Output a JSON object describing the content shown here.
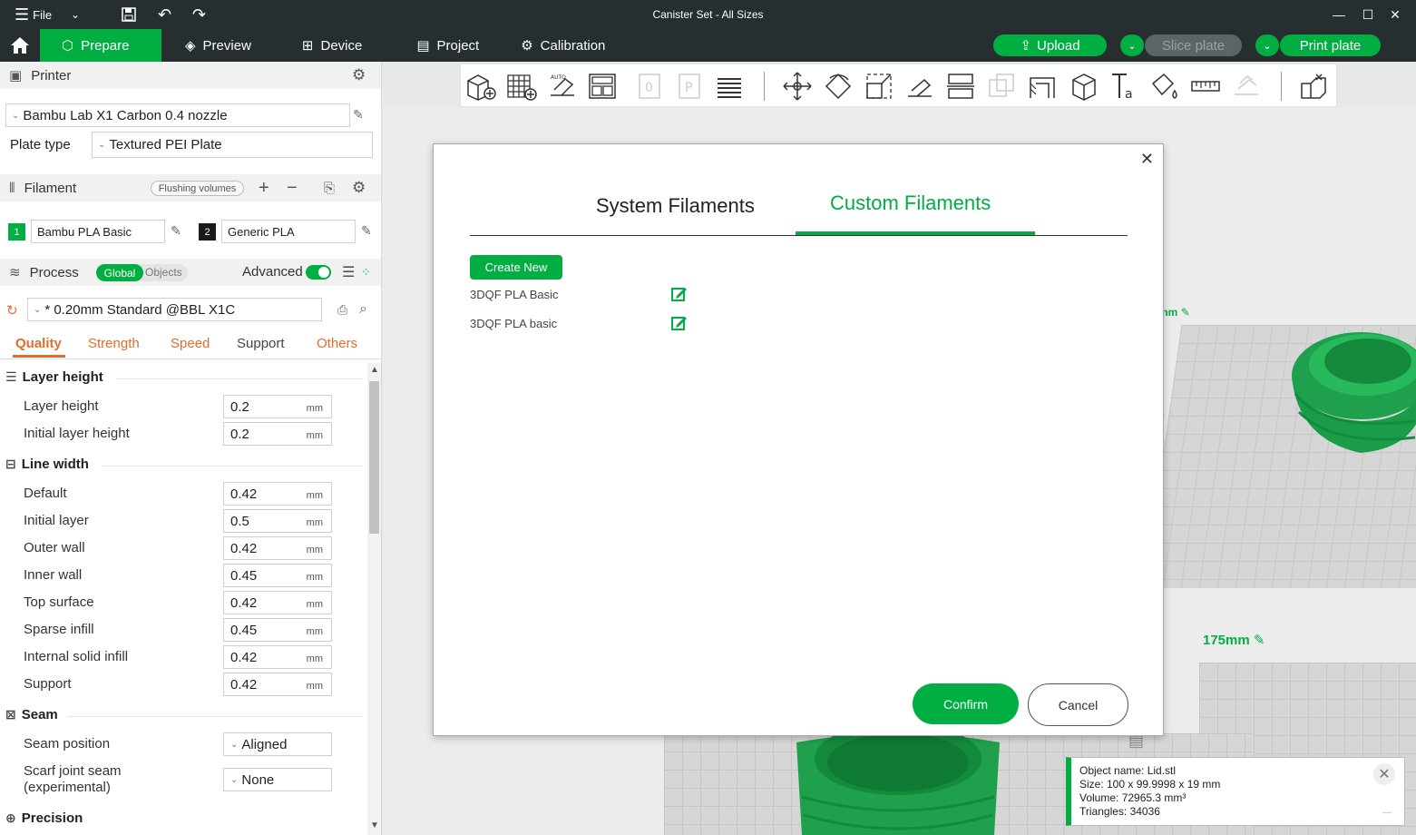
{
  "titlebar": {
    "menu_label": "File",
    "title": "Canister Set - All Sizes"
  },
  "tabs": [
    {
      "label": "Prepare"
    },
    {
      "label": "Preview"
    },
    {
      "label": "Device"
    },
    {
      "label": "Project"
    },
    {
      "label": "Calibration"
    }
  ],
  "actions": {
    "upload": "Upload",
    "slice": "Slice plate",
    "print": "Print plate"
  },
  "printer": {
    "section": "Printer",
    "name": "Bambu Lab X1 Carbon 0.4 nozzle",
    "plate_label": "Plate type",
    "plate_value": "Textured PEI Plate"
  },
  "filament": {
    "section": "Filament",
    "flushing": "Flushing volumes",
    "slots": [
      {
        "num": "1",
        "name": "Bambu PLA Basic",
        "color": "#00ae42"
      },
      {
        "num": "2",
        "name": "Generic PLA",
        "color": "#1a1a1a"
      }
    ]
  },
  "process": {
    "section": "Process",
    "global": "Global",
    "objects": "Objects",
    "advanced": "Advanced",
    "preset": "* 0.20mm Standard @BBL X1C",
    "subtabs": [
      "Quality",
      "Strength",
      "Speed",
      "Support",
      "Others"
    ]
  },
  "params": {
    "layer_height_group": "Layer height",
    "layer_height": {
      "label": "Layer height",
      "value": "0.2"
    },
    "initial_layer_height": {
      "label": "Initial layer height",
      "value": "0.2"
    },
    "line_width_group": "Line width",
    "default": {
      "label": "Default",
      "value": "0.42"
    },
    "initial_layer": {
      "label": "Initial layer",
      "value": "0.5"
    },
    "outer_wall": {
      "label": "Outer wall",
      "value": "0.42"
    },
    "inner_wall": {
      "label": "Inner wall",
      "value": "0.45"
    },
    "top_surface": {
      "label": "Top surface",
      "value": "0.42"
    },
    "sparse_infill": {
      "label": "Sparse infill",
      "value": "0.45"
    },
    "internal_solid_infill": {
      "label": "Internal solid infill",
      "value": "0.42"
    },
    "support": {
      "label": "Support",
      "value": "0.42"
    },
    "seam_group": "Seam",
    "seam_position": {
      "label": "Seam position",
      "value": "Aligned"
    },
    "scarf_line1": "Scarf joint seam",
    "scarf_line2": "(experimental)",
    "scarf_value": "None",
    "precision_group": "Precision",
    "unit": "mm"
  },
  "viewport": {
    "dim1": "175mm",
    "dim2": "mm"
  },
  "modal": {
    "tab_system": "System Filaments",
    "tab_custom": "Custom Filaments",
    "create_new": "Create New",
    "items": [
      "3DQF PLA Basic",
      "3DQF PLA basic"
    ],
    "confirm": "Confirm",
    "cancel": "Cancel"
  },
  "info": {
    "name": "Object name: Lid.stl",
    "size": "Size: 100 x 99.9998 x 19 mm",
    "volume": "Volume: 72965.3 mm³",
    "triangles": "Triangles: 34036"
  },
  "colors": {
    "accent": "#00ae42",
    "dark": "#262e30",
    "orange": "#e26c2c"
  }
}
